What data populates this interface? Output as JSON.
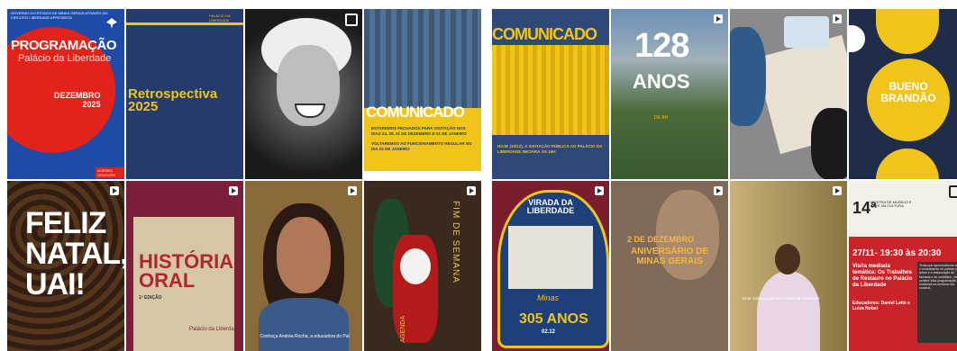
{
  "posts_left": [
    {
      "title": "PROGRAMAÇÃO",
      "subtitle": "Palácio da Liberdade",
      "month": "DEZEMBRO",
      "year": "2025",
      "header": "GOVERNO DO ESTADO DE MINAS GERAIS ATRAVÉS DO CIRCUITO LIBERDADE APRESENTA",
      "badge": "ACESSO GRATUITO"
    },
    {
      "label": "PALÁCIO DA LIBERDADE",
      "title": "Retrospectiva 2025"
    },
    {
      "type": "photo-portrait-bw"
    },
    {
      "title": "COMUNICADO",
      "body1": "ESTAREMOS FECHADOS PARA VISITAÇÃO NOS DIAS 24, 25, 31 DE DEZEMBRO E 01 DE JANEIRO",
      "body2": "VOLTAREMOS AO FUNCIONAMENTO REGULAR NO DIA 02 DE JANEIRO"
    },
    {
      "title": "FELIZ NATAL, UAI!"
    },
    {
      "title": "HISTÓRIA ORAL",
      "edition": "1ª EDIÇÃO",
      "footer": "Palácio da Liberdade"
    },
    {
      "caption": "Conheça Andréa Rocha, a educadora do Pal"
    },
    {
      "side_text": "FIM DE SEMANA",
      "tag": "AGENDA"
    }
  ],
  "posts_right": [
    {
      "title": "COMUNICADO",
      "body": "HOJE (10/12), A VISITAÇÃO PÚBLICA AO PALÁCIO DA LIBERDADE INICIARÁ ÀS 15H"
    },
    {
      "number": "128",
      "word": "ANOS",
      "sub": "DE BH"
    },
    {
      "type": "photo-kids-drawing"
    },
    {
      "title": "BUENO BRANDÃO"
    },
    {
      "title": "VIRADA DA LIBERDADE",
      "tag": "Minas",
      "years": "305 ANOS",
      "date": "02.12"
    },
    {
      "date": "2 DE DEZEMBRO",
      "title": "ANIVERSÁRIO DE MINAS GERAIS"
    },
    {
      "caption": "Uma visita guiada ao Palácio da Liberdade"
    },
    {
      "number": "14ª",
      "side": "MOSTRA DE MUSEUS E ARTE NA CULTURA",
      "time": "27/11- 19:30 às 20:30",
      "event": "Visita mediada temática: Os Trabalhos de Restauro no Palácio da Liberdade",
      "educators": "Educadores: Daniel Leite e Luiza Nobel",
      "overlay": "Tenta que apresentamos sobre o tombamento do palácio pelo Iphan e a restauração da fachada e do mobiliário. Venha conferir esta programação exclusiva na semana dos museus."
    }
  ]
}
